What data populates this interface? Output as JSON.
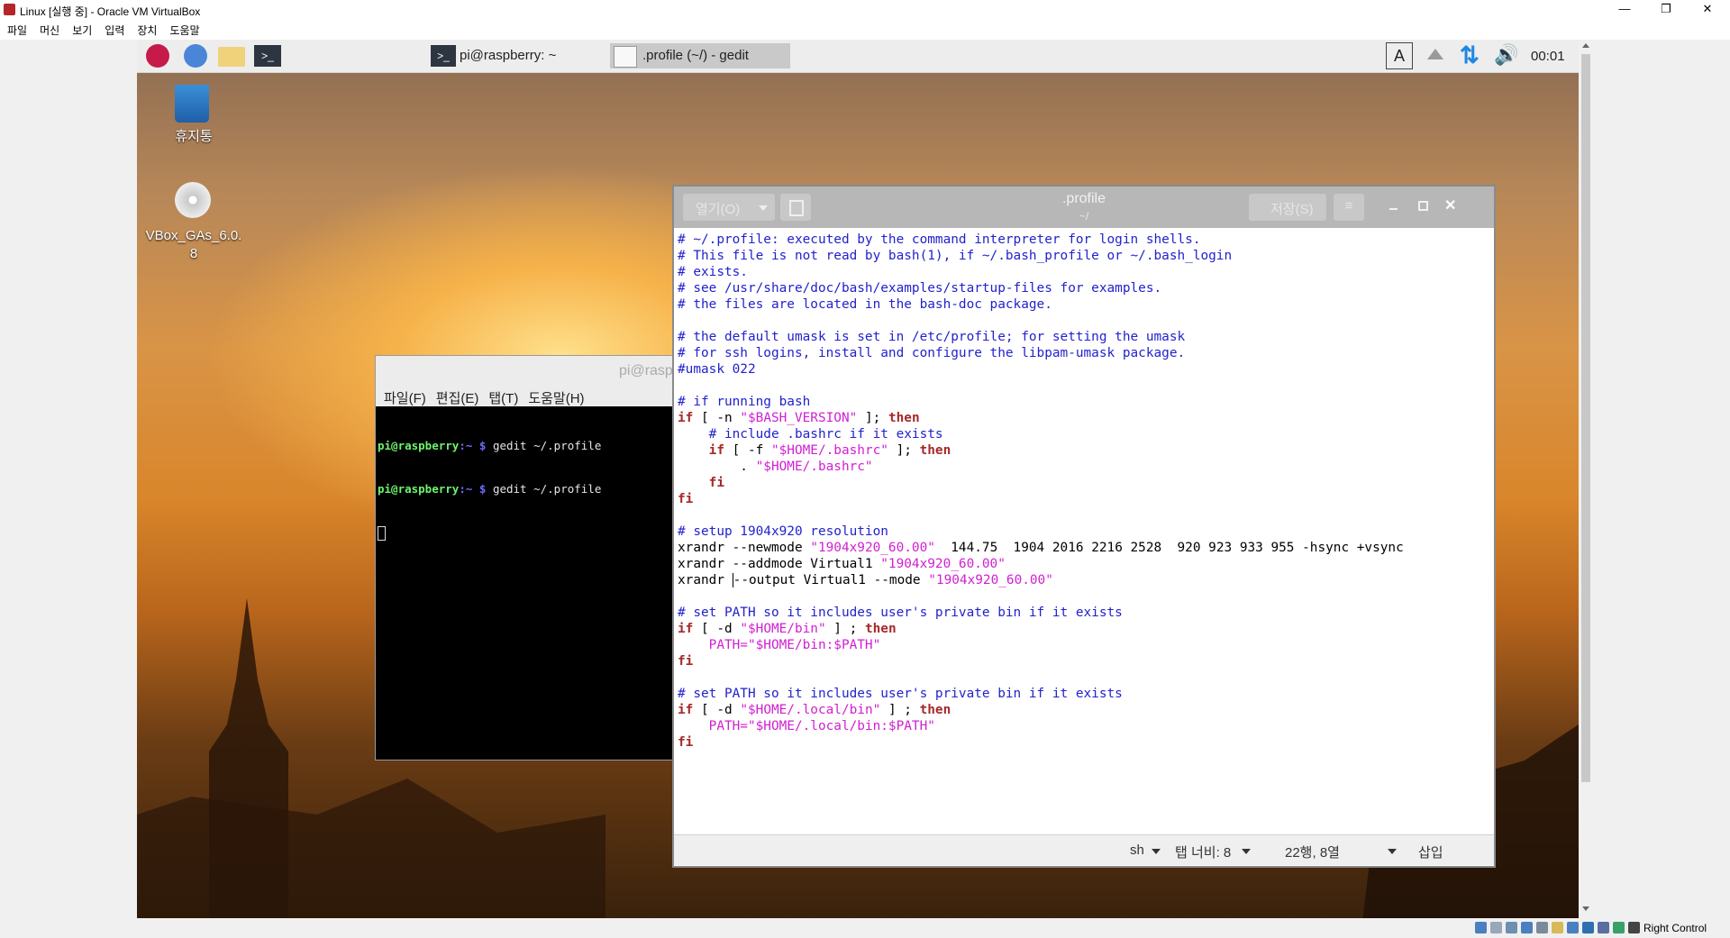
{
  "host": {
    "title": "Linux [실행 중] - Oracle VM VirtualBox",
    "menu": [
      "파일",
      "머신",
      "보기",
      "입력",
      "장치",
      "도움말"
    ],
    "win_minimize": "—",
    "win_restore": "❐",
    "win_close": "✕",
    "host_key": "Right Control"
  },
  "panel": {
    "task_terminal": "pi@raspberry: ~",
    "task_gedit": ".profile (~/) - gedit",
    "clock": "00:01"
  },
  "desktop": {
    "trash_label": "휴지통",
    "cd_label": "VBox_GAs_6.0.8"
  },
  "terminal": {
    "title": "pi@rasp",
    "menu": [
      "파일(F)",
      "편집(E)",
      "탭(T)",
      "도움말(H)"
    ],
    "lines": [
      {
        "user": "pi@raspberry",
        "path": ":~",
        "prompt": " $ ",
        "cmd": "gedit ~/.profile"
      },
      {
        "user": "pi@raspberry",
        "path": ":~",
        "prompt": " $ ",
        "cmd": "gedit ~/.profile"
      }
    ]
  },
  "gedit": {
    "open_label": "열기(O)",
    "save_label": "저장(S)",
    "title": ".profile",
    "subtitle": "~/",
    "code": [
      [
        [
          "cm",
          "# ~/.profile: executed by the command interpreter for login shells."
        ]
      ],
      [
        [
          "cm",
          "# This file is not read by bash(1), if ~/.bash_profile or ~/.bash_login"
        ]
      ],
      [
        [
          "cm",
          "# exists."
        ]
      ],
      [
        [
          "cm",
          "# see /usr/share/doc/bash/examples/startup-files for examples."
        ]
      ],
      [
        [
          "cm",
          "# the files are located in the bash-doc package."
        ]
      ],
      [],
      [
        [
          "cm",
          "# the default umask is set in /etc/profile; for setting the umask"
        ]
      ],
      [
        [
          "cm",
          "# for ssh logins, install and configure the libpam-umask package."
        ]
      ],
      [
        [
          "cm",
          "#umask 022"
        ]
      ],
      [],
      [
        [
          "cm",
          "# if running bash"
        ]
      ],
      [
        [
          "kw",
          "if"
        ],
        [
          "",
          "[ -n "
        ],
        [
          "st",
          "\"$BASH_VERSION\""
        ],
        [
          "",
          " ]; "
        ],
        [
          "kw",
          "then"
        ]
      ],
      [
        [
          "",
          "    "
        ],
        [
          "cm",
          "# include .bashrc if it exists"
        ]
      ],
      [
        [
          "",
          "    "
        ],
        [
          "kw",
          "if"
        ],
        [
          "",
          "[ -f "
        ],
        [
          "st",
          "\"$HOME/.bashrc\""
        ],
        [
          "",
          " ]; "
        ],
        [
          "kw",
          "then"
        ]
      ],
      [
        [
          "",
          "        . "
        ],
        [
          "st",
          "\"$HOME/.bashrc\""
        ]
      ],
      [
        [
          "",
          "    "
        ],
        [
          "kw",
          "fi"
        ]
      ],
      [
        [
          "kw",
          "fi"
        ]
      ],
      [],
      [
        [
          "cm",
          "# setup 1904x920 resolution"
        ]
      ],
      [
        [
          "",
          "xrandr --newmode "
        ],
        [
          "st",
          "\"1904x920_60.00\""
        ],
        [
          "",
          "  144.75  1904 2016 2216 2528  920 923 933 955 -hsync +vsync"
        ]
      ],
      [
        [
          "",
          "xrandr --addmode Virtual1 "
        ],
        [
          "st",
          "\"1904x920_60.00\""
        ]
      ],
      [
        [
          "",
          "xrandr "
        ],
        [
          "cur",
          ""
        ],
        [
          "",
          "--output Virtual1 --mode "
        ],
        [
          "st",
          "\"1904x920_60.00\""
        ]
      ],
      [],
      [
        [
          "cm",
          "# set PATH so it includes user's private bin if it exists"
        ]
      ],
      [
        [
          "kw",
          "if"
        ],
        [
          "",
          "[ -d "
        ],
        [
          "st",
          "\"$HOME/bin\""
        ],
        [
          "",
          " ] ; "
        ],
        [
          "kw",
          "then"
        ]
      ],
      [
        [
          "",
          "    "
        ],
        [
          "st",
          "PATH=\"$HOME/bin:$PATH\""
        ]
      ],
      [
        [
          "kw",
          "fi"
        ]
      ],
      [],
      [
        [
          "cm",
          "# set PATH so it includes user's private bin if it exists"
        ]
      ],
      [
        [
          "kw",
          "if"
        ],
        [
          "",
          "[ -d "
        ],
        [
          "st",
          "\"$HOME/.local/bin\""
        ],
        [
          "",
          " ] ; "
        ],
        [
          "kw",
          "then"
        ]
      ],
      [
        [
          "",
          "    "
        ],
        [
          "st",
          "PATH=\"$HOME/.local/bin:$PATH\""
        ]
      ],
      [
        [
          "kw",
          "fi"
        ]
      ]
    ],
    "status": {
      "lang": "sh",
      "tab_width": "탭 너비: 8",
      "position": "22행, 8열",
      "mode": "삽입"
    }
  }
}
